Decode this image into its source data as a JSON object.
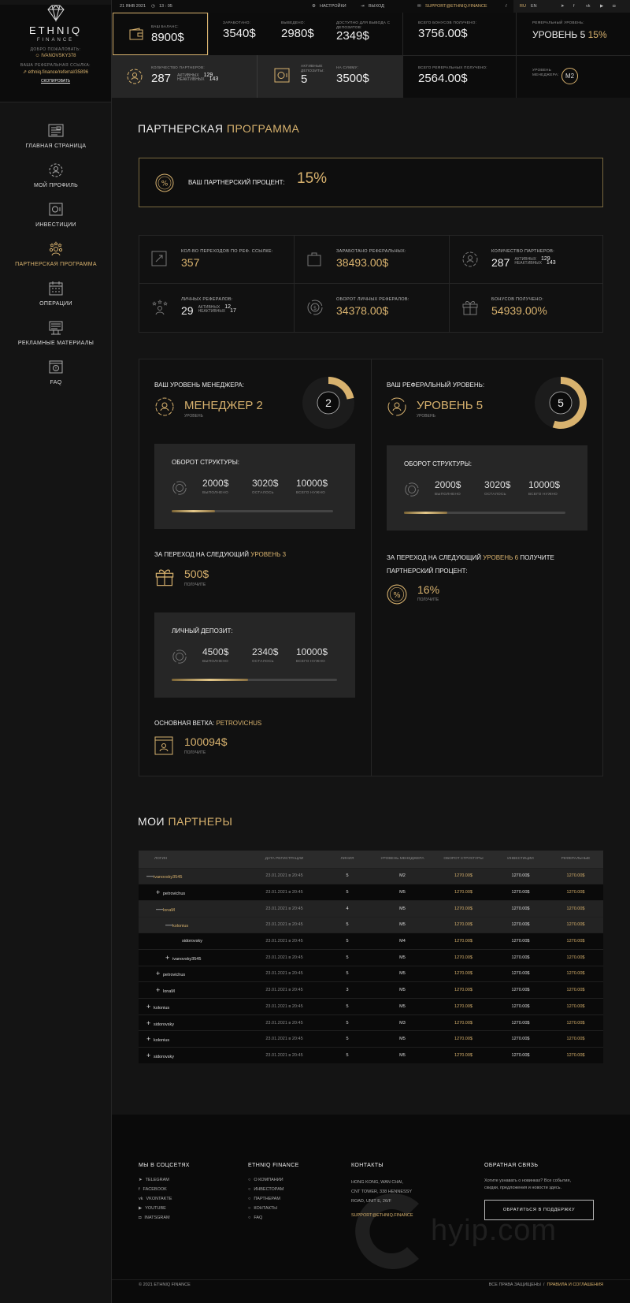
{
  "brand": {
    "name": "ETHNIQ",
    "sub": "FINANCE",
    "welcome": "ДОБРО ПОЖАЛОВАТЬ:",
    "user": "IVANOVSKY378",
    "ref_label": "ВАША РЕФЕРАЛЬНАЯ ССЫЛКА:",
    "ref_link": "ethniq.finance/referral/35896",
    "copy": "СКОПИРОВАТЬ"
  },
  "nav": [
    "ГЛАВНАЯ СТРАНИЦА",
    "МОЙ ПРОФИЛЬ",
    "ИНВЕСТИЦИИ",
    "ПАРТНЕРСКАЯ ПРОГРАММА",
    "ОПЕРАЦИИ",
    "РЕКЛАМНЫЕ МАТЕРИАЛЫ",
    "FAQ"
  ],
  "topbar": {
    "date": "21 ЯНВ 2021",
    "time": "13 : 05",
    "settings": "НАСТРОЙКИ",
    "logout": "ВЫХОД",
    "email": "SUPPORT@ETHNIQ.FINANCE",
    "sep": "/",
    "ru": "RU",
    "en": "EN"
  },
  "stats": {
    "balance": {
      "label": "ВАШ БАЛАНС:",
      "value": "8900$"
    },
    "earned": {
      "label": "ЗАРАБОТАНО:",
      "value": "3540$"
    },
    "withdrawn": {
      "label": "ВЫВЕДЕНО:",
      "value": "2980$"
    },
    "available": {
      "label": "ДОСТУПНО ДЛЯ ВЫВОДА С ДЕПОЗИТОВ:",
      "value": "2349$"
    },
    "bonus": {
      "label": "ВСЕГО БОНУСОВ ПОЛУЧЕНО:",
      "value": "3756.00$"
    },
    "reflevel": {
      "label": "РЕФЕРАЛЬНЫЙ УРОВЕНЬ:",
      "value": "УРОВЕНЬ 5",
      "pct": "15%"
    },
    "partners": {
      "label": "КОЛИЧЕСТВО ПАРТНЕРОВ:",
      "value": "287",
      "active": "АКТИВНЫХ",
      "active_n": "129",
      "inactive": "НЕАКТИВНЫХ",
      "inactive_n": "143"
    },
    "deposits": {
      "label": "АКТИВНЫЕ ДЕПОЗИТЫ:",
      "value": "5"
    },
    "sum": {
      "label": "НА СУММУ:",
      "value": "3500$"
    },
    "refgot": {
      "label": "ВСЕГО РЕФЕРАЛЬНЫХ ПОЛУЧЕНО:",
      "value": "2564.00$"
    },
    "mgr": {
      "label": "УРОВЕНЬ МЕНЕДЖЕРА:",
      "badge": "M2"
    }
  },
  "program": {
    "title_a": "ПАРТНЕРСКАЯ",
    "title_b": "ПРОГРАММА",
    "pct_label": "ВАШ ПАРТНЕРСКИЙ ПРОЦЕНТ:",
    "pct": "15%"
  },
  "kpis": [
    {
      "label": "КОЛ-ВО ПЕРЕХОДОВ ПО РЕФ. ССЫЛКЕ:",
      "value": "357"
    },
    {
      "label": "ЗАРАБОТАНО РЕФЕРАЛЬНЫХ:",
      "value": "38493.00$"
    },
    {
      "label": "КОЛИЧЕСТВО ПАРТНЕРОВ:",
      "value": "287",
      "a": "АКТИВНЫХ",
      "an": "129",
      "i": "НЕАКТИВНЫХ",
      "in": "143"
    },
    {
      "label": "ЛИЧНЫХ РЕФЕРАЛОВ:",
      "value": "29",
      "a": "АКТИВНЫХ",
      "an": "12",
      "i": "НЕАКТИВНЫХ",
      "in": "17"
    },
    {
      "label": "ОБОРОТ ЛИЧНЫХ РЕФЕРАЛОВ:",
      "value": "34378.00$"
    },
    {
      "label": "БОНУСОВ ПОЛУЧЕНО:",
      "value": "54939.00%"
    }
  ],
  "manager": {
    "title": "ВАШ УРОВЕНЬ МЕНЕДЖЕРА:",
    "level": "МЕНЕДЖЕР 2",
    "level_cap": "УРОВЕНЬ",
    "ring": "2",
    "ring_fraction": 0.22,
    "turnover": {
      "title": "ОБОРОТ СТРУКТУРЫ:",
      "done": "2000$",
      "left": "3020$",
      "total": "10000$",
      "c1": "ВЫПОЛНЕНО",
      "c2": "ОСТАЛОСЬ",
      "c3": "ВСЕГО НУЖНО",
      "progress": 0.27
    },
    "next_a": "ЗА ПЕРЕХОД НА СЛЕДУЮЩИЙ",
    "next_b": "УРОВЕНЬ 3",
    "reward": "500$",
    "reward_cap": "ПОЛУЧИТЕ",
    "deposit": {
      "title": "ЛИЧНЫЙ ДЕПОЗИТ:",
      "done": "4500$",
      "left": "2340$",
      "total": "10000$",
      "c1": "ВЫПОЛНЕНО",
      "c2": "ОСТАЛОСЬ",
      "c3": "ВСЕГО НУЖНО",
      "progress": 0.46
    },
    "branch_label": "ОСНОВНАЯ ВЕТКА:",
    "branch_name": "PETROVICHUS",
    "branch_value": "100094$",
    "branch_cap": "ПОЛУЧИТЕ"
  },
  "referral": {
    "title": "ВАШ РЕФЕРАЛЬНЫЙ УРОВЕНЬ:",
    "level": "УРОВЕНЬ 5",
    "level_cap": "УРОВЕНЬ",
    "ring": "5",
    "ring_fraction": 0.55,
    "turnover": {
      "title": "ОБОРОТ СТРУКТУРЫ:",
      "done": "2000$",
      "left": "3020$",
      "total": "10000$",
      "c1": "ВЫПОЛНЕНО",
      "c2": "ОСТАЛОСЬ",
      "c3": "ВСЕГО НУЖНО",
      "progress": 0.27
    },
    "next_a": "ЗА ПЕРЕХОД НА СЛЕДУЮЩИЙ",
    "next_b": "УРОВЕНЬ 6",
    "next_c": "ПОЛУЧИТЕ",
    "next_d": "ПАРТНЕРСКИЙ ПРОЦЕНТ:",
    "reward": "16%",
    "reward_cap": "ПОЛУЧИТЕ"
  },
  "partners": {
    "title_a": "МОИ",
    "title_b": "ПАРТНЕРЫ",
    "headers": [
      "ЛОГИН",
      "ДАТА РЕГИСТРАЦИИ",
      "ЛИНИЯ",
      "УРОВЕНЬ МЕНЕДЖЕРА",
      "ОБОРОТ СТРУКТУРЫ",
      "ИНВЕСТИЦИИ",
      "РЕФЕРАЛЬНЫЕ"
    ],
    "rows": [
      {
        "login": "ivanovsky3545",
        "toggle": "—",
        "indent": 0,
        "gold": true,
        "date": "23.01.2021 в 20:45",
        "line": "5",
        "mgr": "M2",
        "turn": "1270.00$",
        "inv": "1270.00$",
        "ref": "1270.00$"
      },
      {
        "login": "petrovichus",
        "toggle": "+",
        "indent": 1,
        "gold": false,
        "date": "23.01.2021 в 20:45",
        "line": "5",
        "mgr": "M5",
        "turn": "1270.00$",
        "inv": "1270.00$",
        "ref": "1270.00$"
      },
      {
        "login": "lonaM",
        "toggle": "—",
        "indent": 1,
        "gold": true,
        "date": "23.01.2021 в 20:45",
        "line": "4",
        "mgr": "M5",
        "turn": "1270.00$",
        "inv": "1270.00$",
        "ref": "1270.00$"
      },
      {
        "login": "kolonius",
        "toggle": "—",
        "indent": 2,
        "gold": true,
        "date": "23.01.2021 в 20:45",
        "line": "5",
        "mgr": "M5",
        "turn": "1270.00$",
        "inv": "1270.00$",
        "ref": "1270.00$"
      },
      {
        "login": "sidorovsky",
        "toggle": "",
        "indent": 3,
        "gold": false,
        "date": "23.01.2021 в 20:45",
        "line": "5",
        "mgr": "M4",
        "turn": "1270.00$",
        "inv": "1270.00$",
        "ref": "1270.00$"
      },
      {
        "login": "ivanovsky3545",
        "toggle": "+",
        "indent": 2,
        "gold": false,
        "date": "23.01.2021 в 20:45",
        "line": "5",
        "mgr": "M5",
        "turn": "1270.00$",
        "inv": "1270.00$",
        "ref": "1270.00$"
      },
      {
        "login": "petrovichus",
        "toggle": "+",
        "indent": 1,
        "gold": false,
        "date": "23.01.2021 в 20:45",
        "line": "5",
        "mgr": "M5",
        "turn": "1270.00$",
        "inv": "1270.00$",
        "ref": "1270.00$"
      },
      {
        "login": "lonaM",
        "toggle": "+",
        "indent": 1,
        "gold": false,
        "date": "23.01.2021 в 20:45",
        "line": "3",
        "mgr": "M5",
        "turn": "1270.00$",
        "inv": "1270.00$",
        "ref": "1270.00$"
      },
      {
        "login": "kolonius",
        "toggle": "+",
        "indent": 0,
        "gold": false,
        "date": "23.01.2021 в 20:45",
        "line": "5",
        "mgr": "M5",
        "turn": "1270.00$",
        "inv": "1270.00$",
        "ref": "1270.00$"
      },
      {
        "login": "sidorovsky",
        "toggle": "+",
        "indent": 0,
        "gold": false,
        "date": "23.01.2021 в 20:45",
        "line": "5",
        "mgr": "M3",
        "turn": "1270.00$",
        "inv": "1270.00$",
        "ref": "1270.00$"
      },
      {
        "login": "kolonius",
        "toggle": "+",
        "indent": 0,
        "gold": false,
        "date": "23.01.2021 в 20:45",
        "line": "5",
        "mgr": "M5",
        "turn": "1270.00$",
        "inv": "1270.00$",
        "ref": "1270.00$"
      },
      {
        "login": "sidorovsky",
        "toggle": "+",
        "indent": 0,
        "gold": false,
        "date": "23.01.2021 в 20:45",
        "line": "5",
        "mgr": "M5",
        "turn": "1270.00$",
        "inv": "1270.00$",
        "ref": "1270.00$"
      }
    ]
  },
  "footer": {
    "social_title": "МЫ В СОЦСЕТЯХ",
    "social": [
      "TELEGRAM",
      "FACEBOOK",
      "VKONTAKTE",
      "YOUTUBE",
      "INATSGRAM"
    ],
    "co_title": "ETHNIQ FINANCE",
    "co": [
      "О КОМПАНИИ",
      "ИНВЕСТОРАМ",
      "ПАРТНЕРАМ",
      "КОНТАКТЫ",
      "FAQ"
    ],
    "ct_title": "КОНТАКТЫ",
    "address": [
      "HONG KONG, WAN CHAI,",
      "CNT TOWER, 338 HENNESSY",
      "ROAD, UNIT E, 26/F"
    ],
    "email": "SUPPORT@ETHNIQ.FINANCE",
    "fb_title": "ОБРАТНАЯ СВЯЗЬ",
    "fb_text": [
      "Хотите узнавать о новинках? Все события,",
      "скидки, предложения и новости здесь."
    ],
    "fb_button": "ОБРАТИТЬСЯ В ПОДДЕРЖКУ",
    "copyright": "© 2021 ETHNIQ FINANCE",
    "rights": "ВСЕ ПРАВА ЗАЩИЩЕНЫ",
    "sep": "/",
    "terms": "ПРАВИЛА И СОГЛАШЕНИЯ",
    "watermark": "hyip.com"
  },
  "colors": {
    "gold": "#d8b26e",
    "bg": "#141414",
    "dark": "#0a0a0a"
  }
}
